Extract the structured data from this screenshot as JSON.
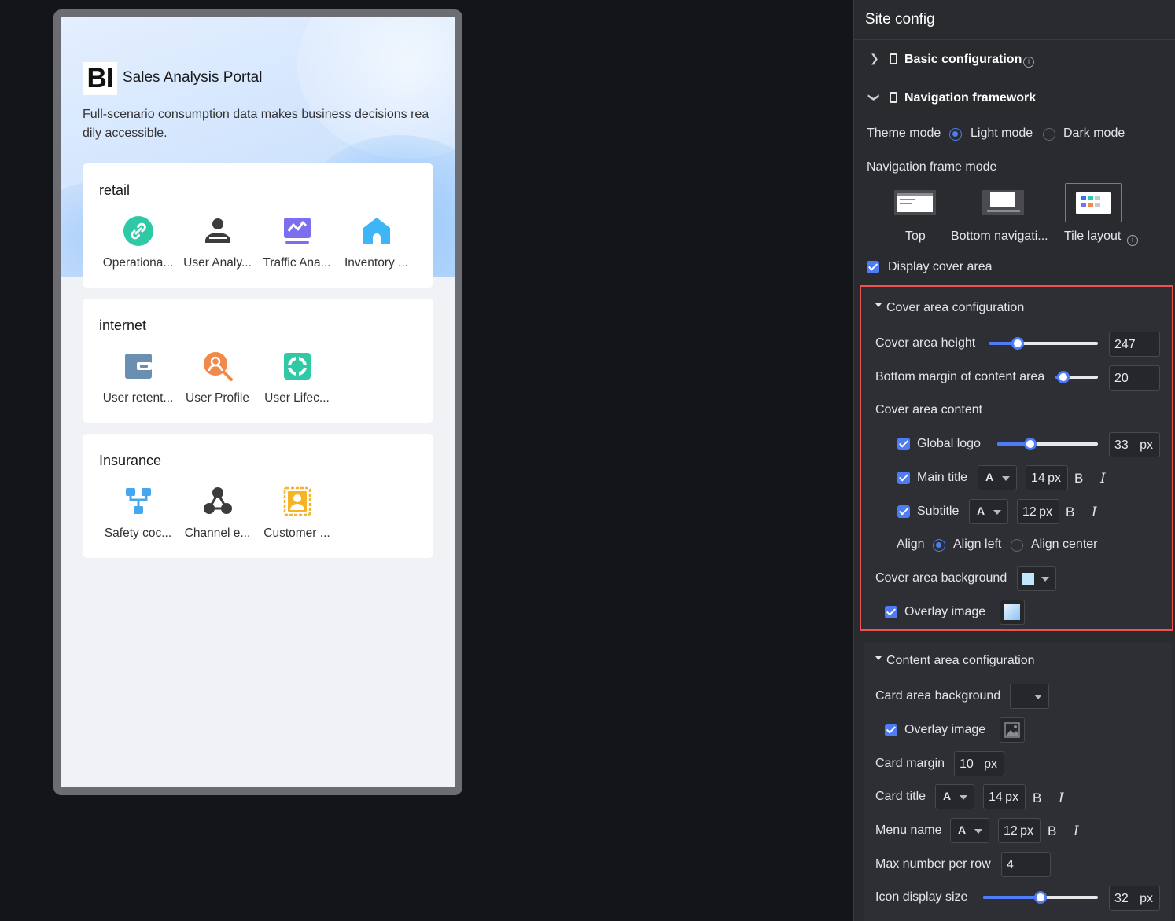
{
  "preview": {
    "logo_text": "BI",
    "main_title": "Sales Analysis Portal",
    "subtitle": "Full-scenario consumption data makes business decisions readily accessible.",
    "cards": [
      {
        "title": "retail",
        "items": [
          {
            "label": "Operationa...",
            "icon": "link-icon",
            "color": "#2fc9a5"
          },
          {
            "label": "User Analy...",
            "icon": "users-icon",
            "color": "#3c3c3c"
          },
          {
            "label": "Traffic Ana...",
            "icon": "analytics-monitor-icon",
            "color": "#7b6ff0"
          },
          {
            "label": "Inventory ...",
            "icon": "home-icon",
            "color": "#3eb6f5"
          }
        ]
      },
      {
        "title": "internet",
        "items": [
          {
            "label": "User retent...",
            "icon": "wallet-icon",
            "color": "#6a8fb0"
          },
          {
            "label": "User Profile",
            "icon": "user-search-icon",
            "color": "#f08a4b"
          },
          {
            "label": "User Lifec...",
            "icon": "lifecycle-icon",
            "color": "#2fc9a5"
          }
        ]
      },
      {
        "title": "Insurance",
        "items": [
          {
            "label": "Safety coc...",
            "icon": "org-chart-icon",
            "color": "#46a7f0"
          },
          {
            "label": "Channel e...",
            "icon": "network-icon",
            "color": "#3c3c3c"
          },
          {
            "label": "Customer ...",
            "icon": "contact-card-icon",
            "color": "#f8b324"
          }
        ]
      }
    ]
  },
  "panel": {
    "title": "Site config",
    "basic_config": "Basic configuration",
    "nav_framework": "Navigation framework",
    "theme_mode_label": "Theme mode",
    "theme_light": "Light mode",
    "theme_dark": "Dark mode",
    "nav_frame_mode_label": "Navigation frame mode",
    "modes": [
      "Top",
      "Bottom navigati...",
      "Tile layout"
    ],
    "display_cover": "Display cover area",
    "cover": {
      "title": "Cover area configuration",
      "height_label": "Cover area height",
      "height_value": "247",
      "height_fraction": 0.23,
      "bottom_margin_label": "Bottom margin of content area",
      "bottom_margin_value": "20",
      "bottom_margin_fraction": 0.05,
      "content_label": "Cover area content",
      "global_logo": "Global logo",
      "global_logo_value": "33",
      "global_logo_fraction": 0.3,
      "unit_px": "px",
      "main_title": "Main title",
      "main_title_size": "14",
      "subtitle": "Subtitle",
      "subtitle_size": "12",
      "font_color_letter": "A",
      "bold": "B",
      "italic": "I",
      "align_label": "Align",
      "align_left": "Align left",
      "align_center": "Align center",
      "background_label": "Cover area background",
      "background_color": "#bfe6fb",
      "overlay_image": "Overlay image"
    },
    "content": {
      "title": "Content area configuration",
      "card_bg_label": "Card area background",
      "overlay_image": "Overlay image",
      "card_margin_label": "Card margin",
      "card_margin_value": "10",
      "card_title_label": "Card title",
      "card_title_size": "14",
      "menu_name_label": "Menu name",
      "menu_name_size": "12",
      "max_per_row_label": "Max number per row",
      "max_per_row_value": "4",
      "icon_size_label": "Icon display size",
      "icon_size_value": "32",
      "icon_size_fraction": 0.5
    },
    "accent_color": "#4d7cf6",
    "highlight_color": "#ef5350"
  }
}
